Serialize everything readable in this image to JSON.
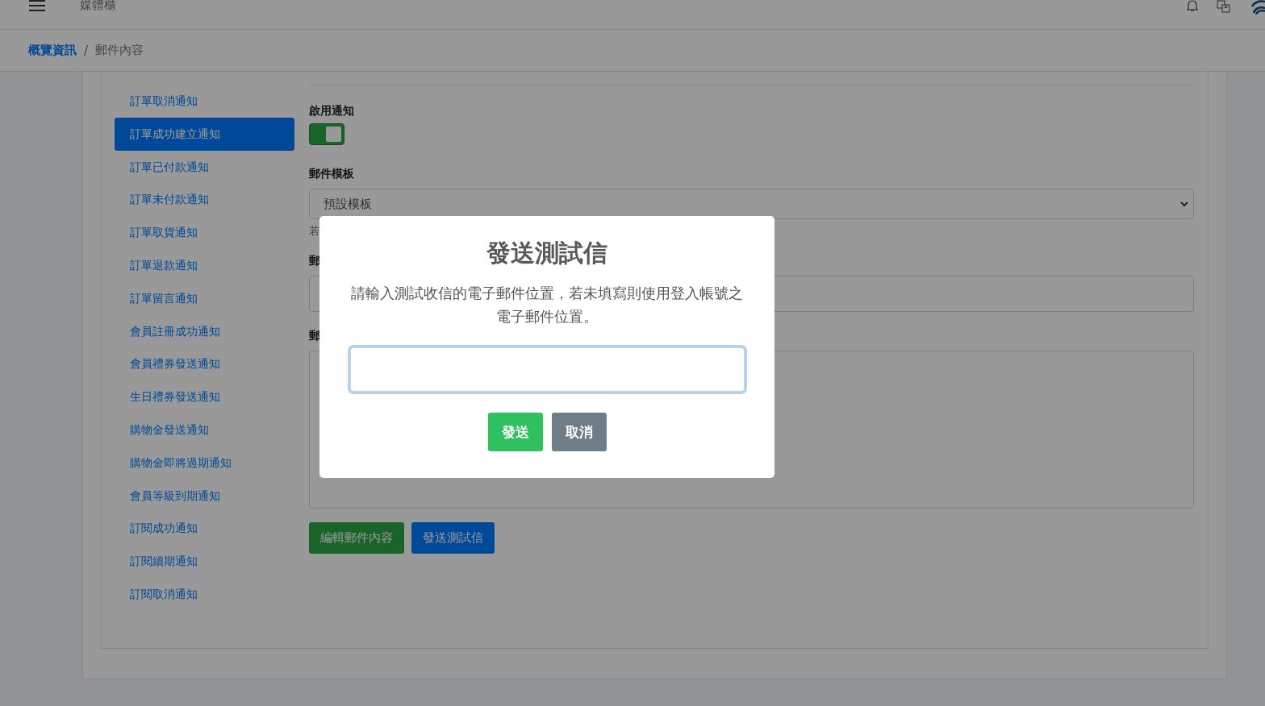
{
  "header": {
    "title": "媒體櫃"
  },
  "breadcrumb": {
    "separator": "/",
    "items": [
      {
        "label": "概覽資訊",
        "link": true
      },
      {
        "label": "郵件內容",
        "link": false
      }
    ]
  },
  "sidebar": {
    "items": [
      {
        "label": "訂單取消通知",
        "selected": false
      },
      {
        "label": "訂單成功建立通知",
        "selected": true
      },
      {
        "label": "訂單已付款通知",
        "selected": false
      },
      {
        "label": "訂單未付款通知",
        "selected": false
      },
      {
        "label": "訂單取貨通知",
        "selected": false
      },
      {
        "label": "訂單退款通知",
        "selected": false
      },
      {
        "label": "訂單留言通知",
        "selected": false
      },
      {
        "label": "會員註冊成功通知",
        "selected": false
      },
      {
        "label": "會員禮券發送通知",
        "selected": false
      },
      {
        "label": "生日禮券發送通知",
        "selected": false
      },
      {
        "label": "購物金發送通知",
        "selected": false
      },
      {
        "label": "購物金即將過期通知",
        "selected": false
      },
      {
        "label": "會員等級到期通知",
        "selected": false
      },
      {
        "label": "訂閱成功通知",
        "selected": false
      },
      {
        "label": "訂閱續期通知",
        "selected": false
      },
      {
        "label": "訂閱取消通知",
        "selected": false
      }
    ]
  },
  "form": {
    "enable_label": "啟用通知",
    "enabled": true,
    "template_label": "郵件模板",
    "template_value": "預設模板",
    "template_hint": "若",
    "subject_label": "郵",
    "body_label": "郵",
    "buttons": [
      {
        "label": "編輯郵件內容",
        "kind": "edit"
      },
      {
        "label": "發送測試信",
        "kind": "test"
      }
    ]
  },
  "modal": {
    "title": "發送測試信",
    "message": "請輸入測試收信的電子郵件位置，若未填寫則使用登入帳號之電子郵件位置。",
    "buttons": [
      {
        "label": "發送",
        "kind": "confirm"
      },
      {
        "label": "取消",
        "kind": "cancel"
      }
    ]
  }
}
